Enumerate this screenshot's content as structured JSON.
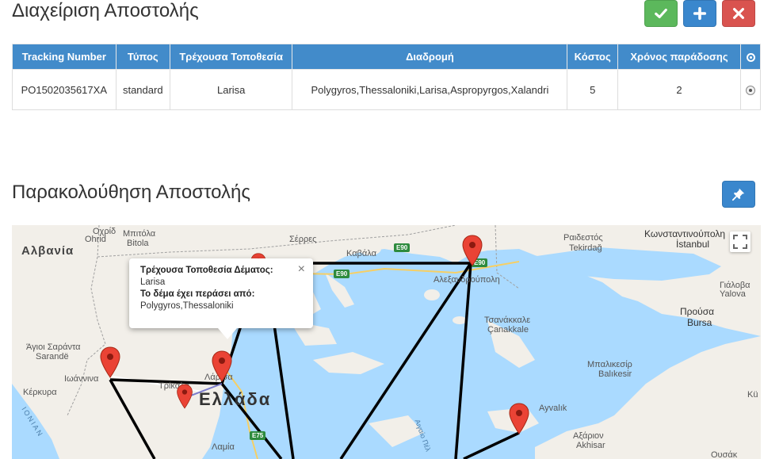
{
  "header": {
    "title": "Διαχείριση Αποστολής",
    "actions": {
      "confirm_icon": "check-icon",
      "add_icon": "plus-icon",
      "remove_icon": "close-icon"
    }
  },
  "table": {
    "columns": [
      "Tracking Number",
      "Τύπος",
      "Τρέχουσα Τοποθεσία",
      "Διαδρομή",
      "Κόστος",
      "Χρόνος παράδοσης"
    ],
    "select_column_icon": "radio-icon",
    "rows": [
      {
        "tracking": "PO1502035617XA",
        "type": "standard",
        "location": "Larisa",
        "route": "Polygyros,Thessaloniki,Larisa,Aspropyrgos,Xalandri",
        "cost": "5",
        "delivery_time": "2",
        "selected": true
      }
    ]
  },
  "tracking": {
    "title": "Παρακολούθηση Αποστολής",
    "pin_icon": "pushpin-icon"
  },
  "map": {
    "labels": {
      "albania": "Αλβανία",
      "greece": "Ελλάδα",
      "ohrid": "Οχρίδ",
      "ochrida": "Ohrid",
      "bitola": "Μπιτόλα",
      "bitola_en": "Bitola",
      "serres": "Σέρρες",
      "kavala": "Καβάλα",
      "alexandroupoli": "Αλεξανδρούπολη",
      "raidestos": "Ραιδεστός",
      "tekirdag": "Tekirdağ",
      "konstantinoupoli": "Κωνσταντινούπολη",
      "istanbul": "İstanbul",
      "saranta": "Άγιοι Σαράντα",
      "sarande": "Sarandë",
      "ioannina": "Ιωάννινα",
      "kerkyra": "Κέρκυρα",
      "trikala": "Τρίκαλα",
      "larisa": "Λάρισα",
      "lamia": "Λαμία",
      "canakkale_gr": "Τσανάκκαλε",
      "canakkale": "Çanakkale",
      "prousa": "Προύσα",
      "bursa": "Bursa",
      "yalova_gr": "Γιάλοβα",
      "yalova": "Yalova",
      "balikesir_gr": "Μπαλικεσίρ",
      "balikesir": "Balıkesir",
      "akhisar_gr": "Αξάριον",
      "akhisar": "Akhisar",
      "ayvalik": "Ayvalık",
      "ousak": "Ουσάκ",
      "ionian": "IONIAN",
      "aegean": "Αιγαίο Πέλ",
      "ki": "Kü",
      "e90a": "E90",
      "e90b": "E90",
      "e90c": "E90",
      "e75": "E75"
    },
    "infowindow": {
      "current_label": "Τρέχουσα Τοποθεσία Δέματος:",
      "current_value": "Larisa",
      "passed_label": "Το δέμα έχει περάσει από:",
      "passed_value": "Polygyros,Thessaloniki",
      "close_symbol": "×"
    },
    "fullscreen_icon": "fullscreen-icon",
    "marker_icon": "map-pin-icon",
    "colors": {
      "water": "#aadaff",
      "land": "#f2efe9",
      "route": "#000000",
      "marker": "#ea4335"
    }
  },
  "colors": {
    "primary": "#428bca",
    "success": "#5cb85c",
    "danger": "#d9534f"
  }
}
